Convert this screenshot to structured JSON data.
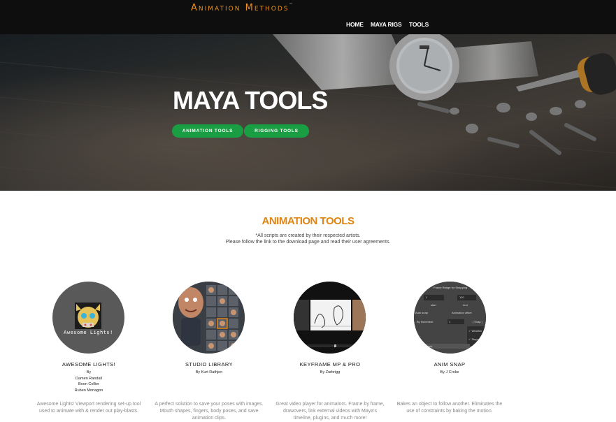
{
  "header": {
    "logo_text": "Animation Methods",
    "logo_tm": "™",
    "nav": [
      "HOME",
      "MAYA RIGS",
      "TOOLS"
    ]
  },
  "hero": {
    "title": "MAYA TOOLS",
    "buttons": [
      "ANIMATION TOOLS",
      "RIGGING TOOLS"
    ]
  },
  "section": {
    "title": "ANIMATION TOOLS",
    "note_line1": "*All scripts are created by their respected artists.",
    "note_line2": "Please follow the link to the download page and read their user agreements."
  },
  "tools": [
    {
      "name": "AWESOME LIGHTS!",
      "by": "By",
      "authors": [
        "Damen Randall",
        "Boon Collier",
        "Ruben Monagon"
      ],
      "thumb_text": "Awesome Lights!",
      "desc": "Awesome Lights! Viewport rendering set-up tool used to animate with & render out play-blasts."
    },
    {
      "name": "STUDIO LIBRARY",
      "by": "By Kurt Rathjen",
      "desc": "A perfect solution to save your poses with images. Mouth shapes, fingers, body poses, and save animation clips."
    },
    {
      "name": "KEYFRAME MP & PRO",
      "by": "By Zurbrigg",
      "desc": "Great video player for animators. Frame by frame, drawovers, link external videos with Maya's timeline, plugins, and much more!"
    },
    {
      "name": "ANIM SNAP",
      "by": "By J Croke",
      "thumb": {
        "dialog_title": "Frame Range for Snapping",
        "start_label": "start",
        "end_label": "end",
        "start_value": "1",
        "end_value": "120",
        "opt1": "Auto snap",
        "opt2": "Animation offset",
        "by_increment": "By increment",
        "increment_value": "1",
        "snap_button": "[ Snap ]",
        "menu1": "✓ Weather",
        "menu2": "✓ Steps",
        "close": "Close"
      },
      "desc": "Bakes an object to follow another. Eliminates the use of constraints by baking the motion."
    }
  ],
  "colors": {
    "accent_orange": "#e08412",
    "button_green": "#1a9e43",
    "topbar": "#0e0e0e"
  }
}
